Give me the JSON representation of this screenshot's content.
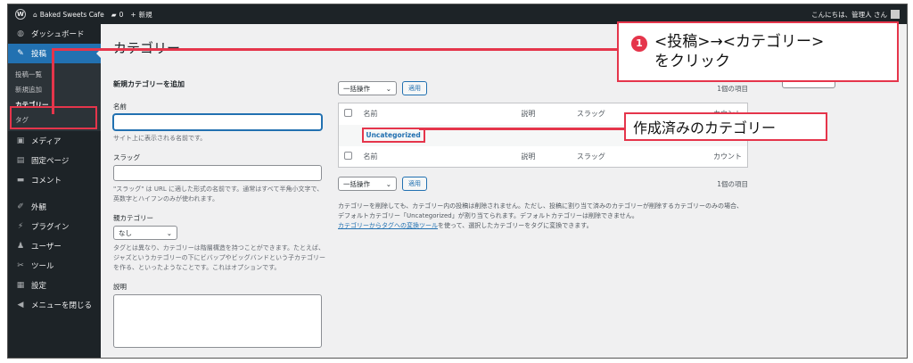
{
  "admin_bar": {
    "site_name": "Baked Sweets Cafe",
    "comments_count": "0",
    "new_label": "新規",
    "greeting": "こんにちは、管理人 さん"
  },
  "sidebar": {
    "items": [
      {
        "icon": "dashboard-icon",
        "glyph": "◍",
        "label": "ダッシュボード"
      },
      {
        "icon": "pin-icon",
        "glyph": "✎",
        "label": "投稿",
        "current": true
      },
      {
        "icon": "media-icon",
        "glyph": "▣",
        "label": "メディア"
      },
      {
        "icon": "page-icon",
        "glyph": "▤",
        "label": "固定ページ"
      },
      {
        "icon": "comment-icon",
        "glyph": "▬",
        "label": "コメント"
      },
      {
        "icon": "appearance-icon",
        "glyph": "✐",
        "label": "外観"
      },
      {
        "icon": "plugin-icon",
        "glyph": "⚡",
        "label": "プラグイン"
      },
      {
        "icon": "users-icon",
        "glyph": "♟",
        "label": "ユーザー"
      },
      {
        "icon": "tools-icon",
        "glyph": "✂",
        "label": "ツール"
      },
      {
        "icon": "settings-icon",
        "glyph": "▦",
        "label": "設定"
      },
      {
        "icon": "collapse-icon",
        "glyph": "◀",
        "label": "メニューを閉じる"
      }
    ],
    "submenu": [
      "投稿一覧",
      "新規追加",
      "カテゴリー",
      "タグ"
    ]
  },
  "page": {
    "title": "カテゴリー"
  },
  "form": {
    "heading": "新規カテゴリーを追加",
    "name_label": "名前",
    "name_help": "サイト上に表示される名前です。",
    "slug_label": "スラッグ",
    "slug_help": "\"スラッグ\" は URL に適した形式の名前です。通常はすべて半角小文字で、英数字とハイフンのみが使われます。",
    "parent_label": "親カテゴリー",
    "parent_value": "なし",
    "parent_help": "タグとは異なり、カテゴリーは階層構造を持つことができます。たとえば、ジャズというカテゴリーの下にビバップやビッグバンドという子カテゴリーを作る、といったようなことです。これはオプションです。",
    "description_label": "説明"
  },
  "list": {
    "bulk_action": "一括操作",
    "apply": "適用",
    "count_top": "1個の項目",
    "count_bottom": "1個の項目",
    "columns": [
      "名前",
      "説明",
      "スラッグ",
      "カウント"
    ],
    "rows": [
      {
        "name": "Uncategorized",
        "description": "",
        "slug": "",
        "count": ""
      }
    ],
    "note_line1": "カテゴリーを削除しても、カテゴリー内の投稿は削除されません。ただし、投稿に割り当て済みのカテゴリーが削除するカテゴリーのみの場合、デフォルトカテゴリー「Uncategorized」が割り当てられます。デフォルトカテゴリーは削除できません。",
    "note_link": "カテゴリーからタグへの変換ツール",
    "note_line2": "を使って、選択したカテゴリーをタグに変換できます。"
  },
  "annotations": {
    "step_number": "1",
    "step_line1": "<投稿>→<カテゴリー>",
    "step_line2": "をクリック",
    "existing_category": "作成済みのカテゴリー",
    "highlight_color": "#e5354b"
  }
}
